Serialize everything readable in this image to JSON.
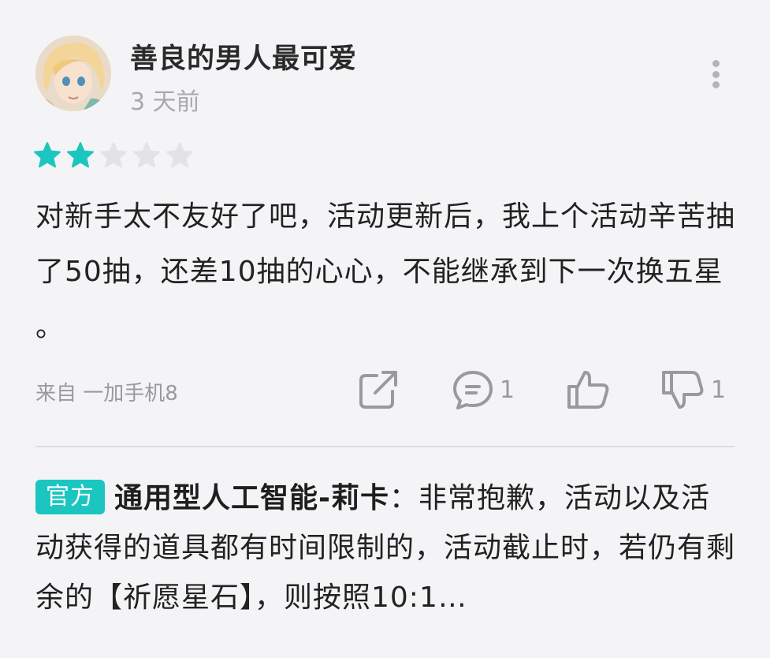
{
  "user": {
    "name": "善良的男人最可爱",
    "time": "3 天前"
  },
  "rating": {
    "value": 2,
    "max": 5,
    "filled_color": "#1bc6c0",
    "empty_color": "#e2e3e6"
  },
  "review": {
    "text": "对新手太不友好了吧，活动更新后，我上个活动辛苦抽了50抽，还差10抽的心心，不能继承到下一次换五星 。"
  },
  "footer": {
    "device": "来自 一加手机8",
    "comment_count": "1",
    "dislike_count": "1",
    "icons": [
      "share-icon",
      "comment-icon",
      "like-icon",
      "dislike-icon",
      "more-icon"
    ]
  },
  "reply": {
    "badge": "官方",
    "author": "通用型人工智能-莉卡",
    "separator": "：",
    "text": "非常抱歉，活动以及活动获得的道具都有时间限制的，活动截止时，若仍有剩余的【祈愿星石】，则按照10:1…"
  }
}
